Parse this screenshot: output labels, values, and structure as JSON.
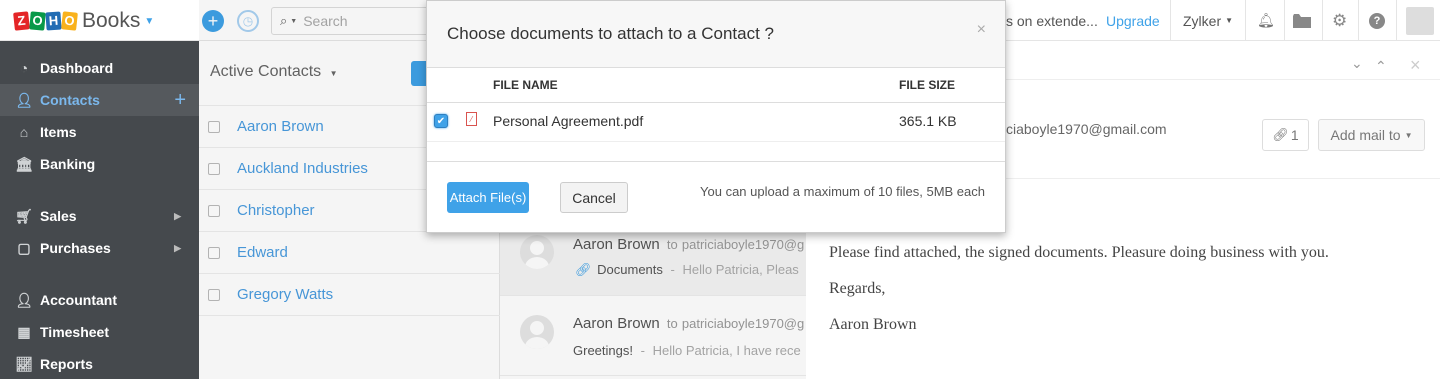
{
  "topbar": {
    "logo_letters": [
      "Z",
      "O",
      "H",
      "O"
    ],
    "logo_colors": [
      "#e42527",
      "#089949",
      "#226db4",
      "#f9b21d"
    ],
    "app_name": "Books",
    "search_placeholder": "Search",
    "notice_text": "s on extende...",
    "upgrade_label": "Upgrade",
    "org_name": "Zylker",
    "icons": [
      "plus-icon",
      "history-icon",
      "bell-icon",
      "folder-icon",
      "gear-icon",
      "help-icon",
      "user-avatar"
    ]
  },
  "sidebar": {
    "items": [
      {
        "label": "Dashboard",
        "icon": "dashboard-icon"
      },
      {
        "label": "Contacts",
        "icon": "user-icon",
        "active": true
      },
      {
        "label": "Items",
        "icon": "basket-icon"
      },
      {
        "label": "Banking",
        "icon": "bank-icon"
      },
      {
        "label": "Sales",
        "icon": "cart-icon",
        "submenu": true
      },
      {
        "label": "Purchases",
        "icon": "bag-icon",
        "submenu": true
      },
      {
        "label": "Accountant",
        "icon": "accountant-icon"
      },
      {
        "label": "Timesheet",
        "icon": "calendar-icon"
      },
      {
        "label": "Reports",
        "icon": "chart-icon"
      }
    ]
  },
  "contacts": {
    "header": "Active Contacts",
    "rows": [
      "Aaron Brown",
      "Auckland Industries",
      "Christopher",
      "Edward",
      "Gregory Watts"
    ]
  },
  "mails": [
    {
      "from": "Aaron Brown",
      "to_prefix": "to",
      "to": "patriciaboyle1970@g",
      "attachment_label": "Documents",
      "preview": "Hello Patricia, Pleas"
    },
    {
      "from": "Aaron Brown",
      "to_prefix": "to",
      "to": "patriciaboyle1970@g",
      "subject": "Greetings!",
      "preview": "Hello Patricia, I have rece"
    }
  ],
  "detail": {
    "to_email": "ciaboyle1970@gmail.com",
    "attachment_count": "1",
    "add_mail_label": "Add mail to",
    "body_lines": [
      "Please find attached, the signed documents. Pleasure doing business with you.",
      "Regards,",
      "Aaron Brown"
    ]
  },
  "modal": {
    "title": "Choose documents to attach to a Contact ?",
    "close_glyph": "×",
    "col_file_name": "FILE NAME",
    "col_file_size": "FILE SIZE",
    "files": [
      {
        "name": "Personal Agreement.pdf",
        "size": "365.1 KB",
        "checked": true
      }
    ],
    "attach_label": "Attach File(s)",
    "cancel_label": "Cancel",
    "limit_note": "You can upload a maximum of 10 files, 5MB each"
  },
  "colors": {
    "accent": "#3fa2e8",
    "sidebar_bg": "#45494d",
    "link": "#4a9de0"
  }
}
